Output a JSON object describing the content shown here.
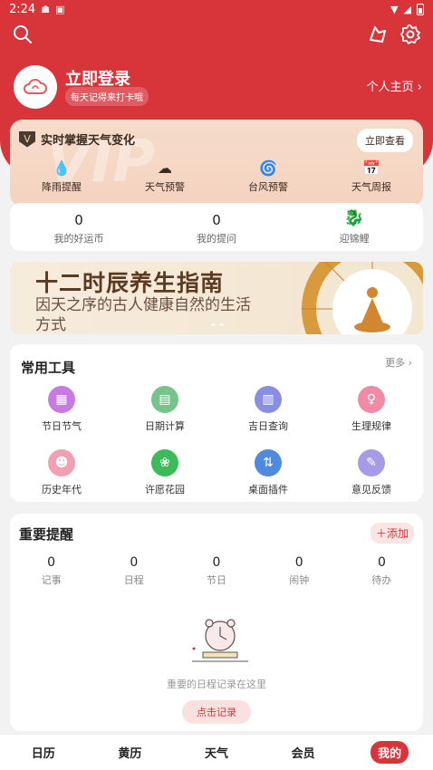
{
  "status_bar": {
    "time": "2:24"
  },
  "header": {
    "login_title": "立即登录",
    "login_subtitle": "每天记得来打卡哦",
    "homepage_link": "个人主页 ›"
  },
  "vip": {
    "watermark": "VIP",
    "title": "实时掌握天气变化",
    "check_button": "立即查看",
    "features": [
      {
        "label": "降雨提醒",
        "icon": "rain-drop-icon"
      },
      {
        "label": "天气预警",
        "icon": "cloud-warning-icon"
      },
      {
        "label": "台风预警",
        "icon": "typhoon-icon"
      },
      {
        "label": "天气周报",
        "icon": "weekly-report-icon"
      }
    ]
  },
  "stats": [
    {
      "num": "0",
      "label": "我的好运币"
    },
    {
      "num": "0",
      "label": "我的提问"
    },
    {
      "emoji": "🐉",
      "label": "迎锦鲤"
    }
  ],
  "banner": {
    "title": "十二时辰养生指南",
    "subtitle": "因天之序的古人健康自然的生活方式"
  },
  "tools": {
    "title": "常用工具",
    "more": "更多 ›",
    "items": [
      {
        "label": "节日节气",
        "color": "#c77be0",
        "glyph": "▦"
      },
      {
        "label": "日期计算",
        "color": "#78c38a",
        "glyph": "▤"
      },
      {
        "label": "吉日查询",
        "color": "#8a8ee0",
        "glyph": "▥"
      },
      {
        "label": "生理规律",
        "color": "#f08aa6",
        "glyph": "♀"
      },
      {
        "label": "历史年代",
        "color": "#f0a0b0",
        "glyph": "☻"
      },
      {
        "label": "许愿花园",
        "color": "#3dbb5a",
        "glyph": "❀"
      },
      {
        "label": "桌面插件",
        "color": "#4f8ae0",
        "glyph": "⇅"
      },
      {
        "label": "意见反馈",
        "color": "#a79ae6",
        "glyph": "✎"
      }
    ]
  },
  "reminders": {
    "title": "重要提醒",
    "add_button": "＋添加",
    "items": [
      {
        "num": "0",
        "label": "记事"
      },
      {
        "num": "0",
        "label": "日程"
      },
      {
        "num": "0",
        "label": "节日"
      },
      {
        "num": "0",
        "label": "闹钟"
      },
      {
        "num": "0",
        "label": "待办"
      }
    ],
    "empty_text": "重要的日程记录在这里",
    "record_button": "点击记录"
  },
  "tabbar": [
    "日历",
    "黄历",
    "天气",
    "会员",
    "我的"
  ],
  "colors": {
    "brand": "#d8353b"
  }
}
